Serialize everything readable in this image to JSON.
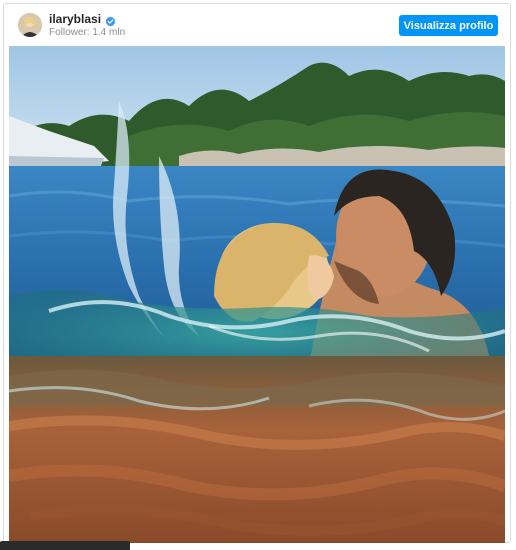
{
  "post_header": {
    "username": "ilaryblasi",
    "verified": true,
    "followers_text": "Follower: 1.4 mln",
    "profile_button_label": "Visualizza profilo"
  },
  "icons": {
    "verified": "verified-badge-icon",
    "avatar": "profile-avatar"
  },
  "colors": {
    "button_bg": "#0095f6",
    "verified_badge": "#3897f0",
    "username_text": "#262626",
    "secondary_text": "#8e8e8e"
  },
  "photo": {
    "subject": "couple-kissing-in-sea-photo"
  }
}
